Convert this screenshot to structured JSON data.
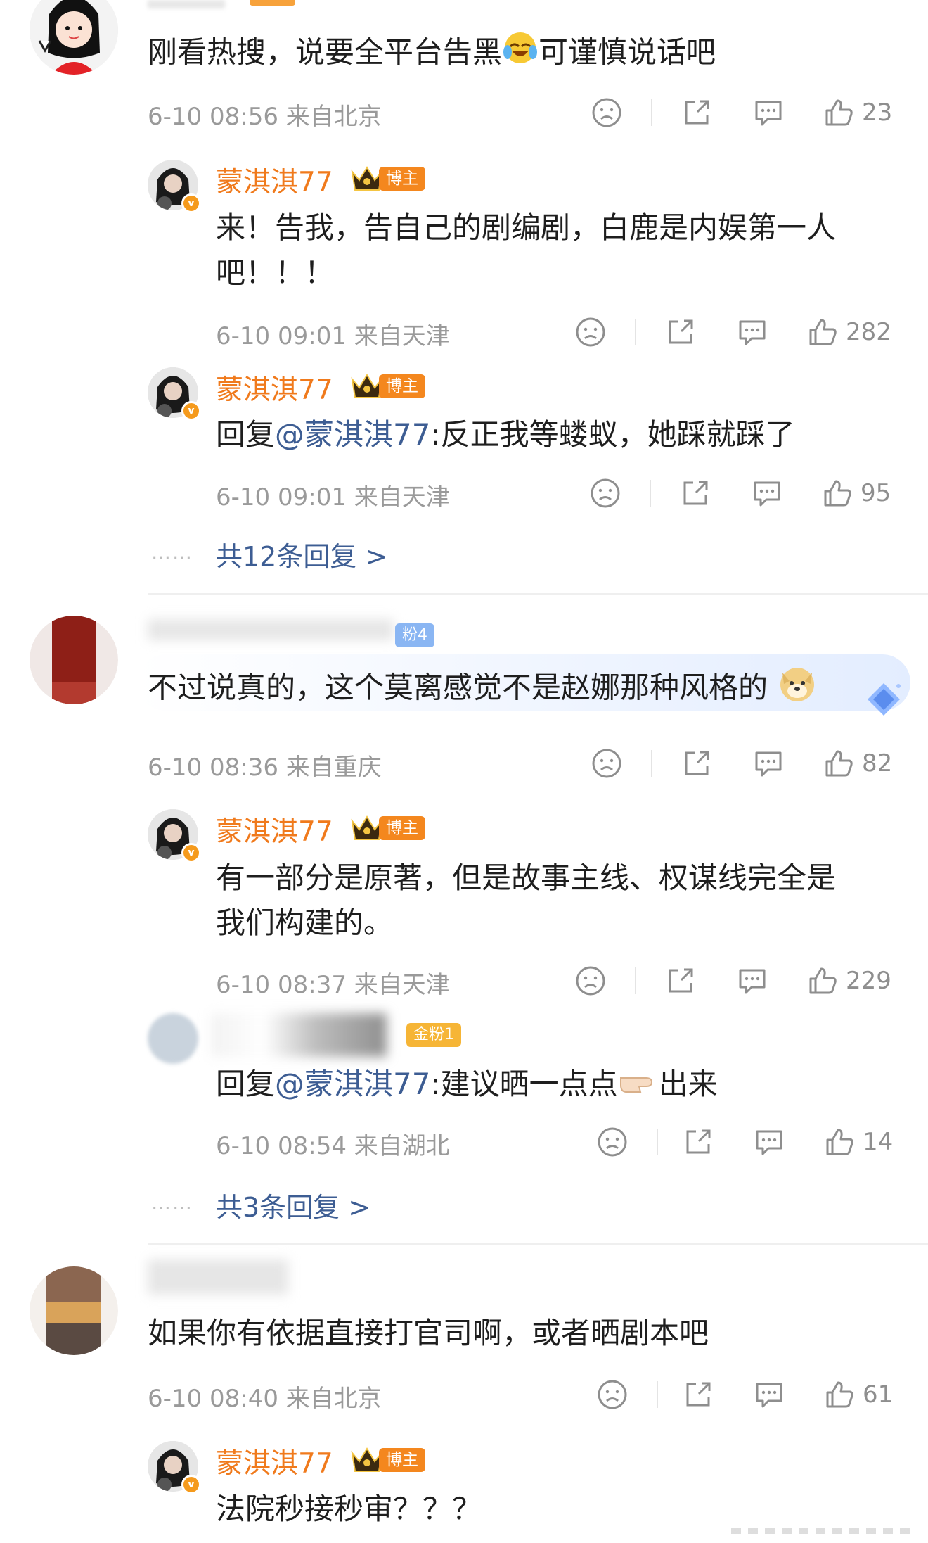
{
  "colors": {
    "nickname": "#f07a1c",
    "mention": "#3d5d93",
    "meta": "#9a9a9a",
    "boss_badge": "#f4871e",
    "fan_badge": "#f6b536",
    "text": "#1e1e1e"
  },
  "icons": [
    "frown-icon",
    "share-icon",
    "comment-icon",
    "like-icon",
    "verified-icon",
    "crown-icon"
  ],
  "c1": {
    "text_a": "刚看热搜，说要全平台告黑",
    "text_b": "可谨慎说话吧",
    "time": "6-10 08:56",
    "location": "来自北京",
    "likes": "23",
    "replies": [
      {
        "name": "蒙淇淇77",
        "badge": "博主",
        "text_line1": "来！告我，告自己的剧编剧，白鹿是内娱第一人",
        "text_line2": "吧！！！",
        "time": "6-10 09:01",
        "location": "来自天津",
        "likes": "282"
      },
      {
        "name": "蒙淇淇77",
        "badge": "博主",
        "reply_prefix": "回复",
        "mention": "@蒙淇淇77",
        "text": ":反正我等蝼蚁，她踩就踩了",
        "time": "6-10 09:01",
        "location": "来自天津",
        "likes": "95"
      }
    ],
    "more_dots": "……",
    "more": "共12条回复 >"
  },
  "c2": {
    "fan_badge": "粉4",
    "text": "不过说真的，这个莫离感觉不是赵娜那种风格的",
    "time": "6-10 08:36",
    "location": "来自重庆",
    "likes": "82",
    "replies": [
      {
        "name": "蒙淇淇77",
        "badge": "博主",
        "text_line1": "有一部分是原著，但是故事主线、权谋线完全是",
        "text_line2": "我们构建的。",
        "time": "6-10 08:37",
        "location": "来自天津",
        "likes": "229"
      },
      {
        "badge": "金粉1",
        "reply_prefix": "回复",
        "mention": "@蒙淇淇77",
        "text_a": ":建议晒一点点",
        "text_b": "出来",
        "time": "6-10 08:54",
        "location": "来自湖北",
        "likes": "14"
      }
    ],
    "more_dots": "……",
    "more": "共3条回复 >"
  },
  "c3": {
    "text": "如果你有依据直接打官司啊，或者晒剧本吧",
    "time": "6-10 08:40",
    "location": "来自北京",
    "likes": "61",
    "replies": [
      {
        "name": "蒙淇淇77",
        "badge": "博主",
        "text": "法院秒接秒审？？？"
      }
    ]
  }
}
